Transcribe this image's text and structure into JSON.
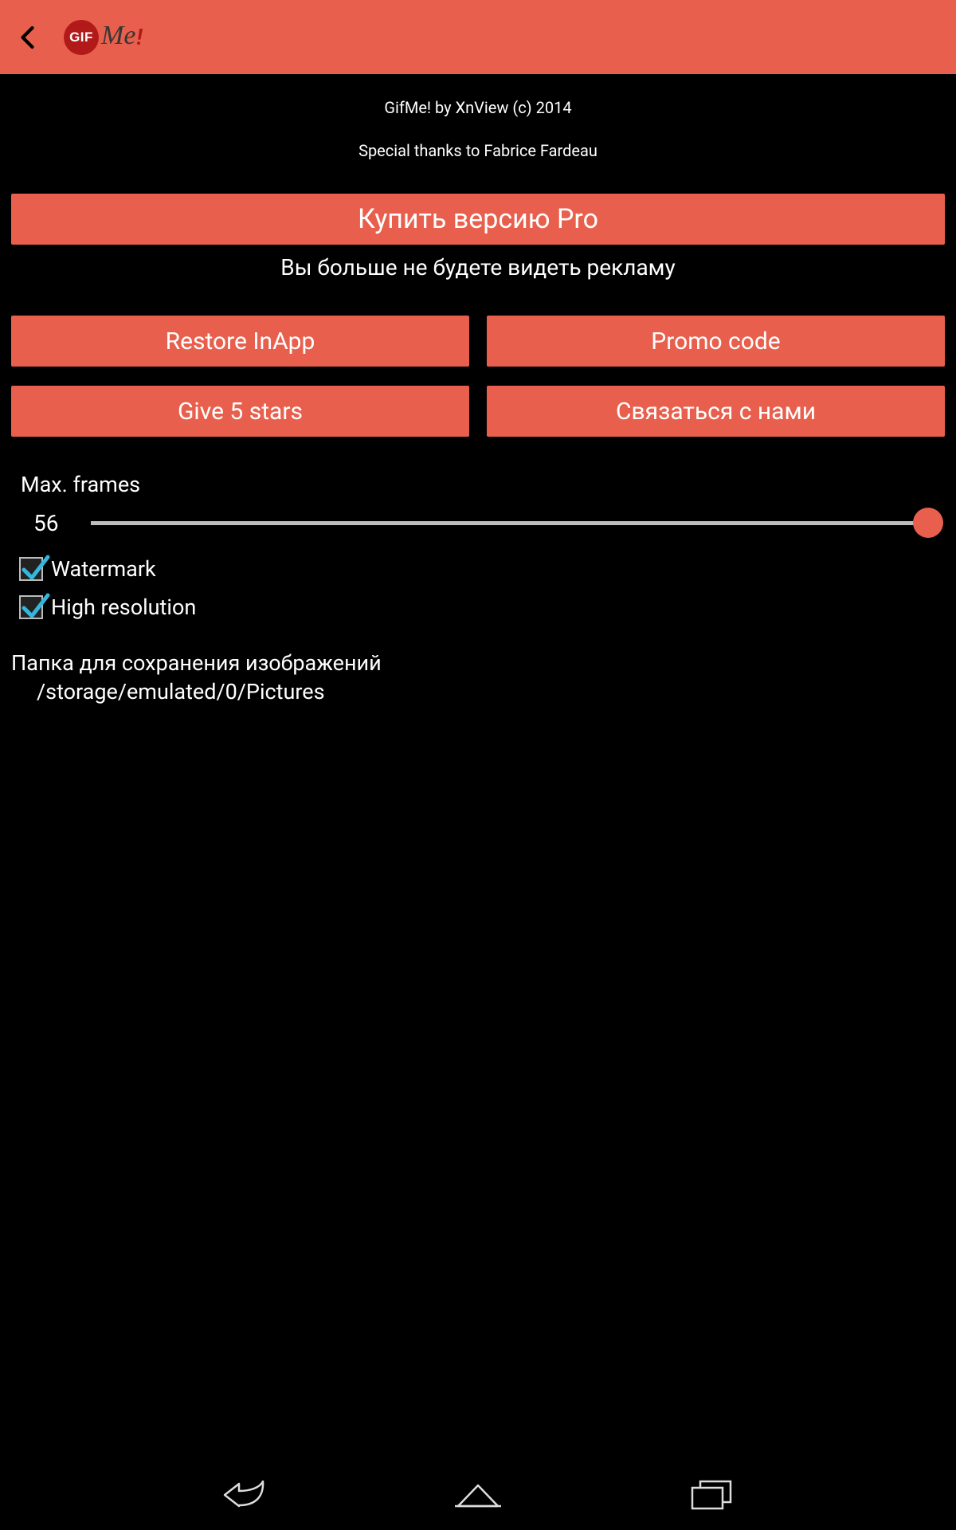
{
  "header": {
    "logo": {
      "gif": "GIF",
      "me": "Me",
      "bang": "!"
    }
  },
  "about": {
    "line1": "GifMe! by XnView (c) 2014",
    "line2": "Special thanks to Fabrice Fardeau"
  },
  "buttons": {
    "buy_pro": "Купить версию Pro",
    "no_ads_text": "Вы больше не будете видеть рекламу",
    "restore_inapp": "Restore InApp",
    "promo_code": "Promo code",
    "give_five_stars": "Give 5 stars",
    "contact_us": "Связаться с нами"
  },
  "settings": {
    "max_frames_label": "Max. frames",
    "max_frames_value": "56",
    "watermark_label": "Watermark",
    "watermark_checked": true,
    "high_res_label": "High resolution",
    "high_res_checked": true
  },
  "storage": {
    "folder_label": "Папка для сохранения изображений",
    "folder_path": "/storage/emulated/0/Pictures"
  }
}
